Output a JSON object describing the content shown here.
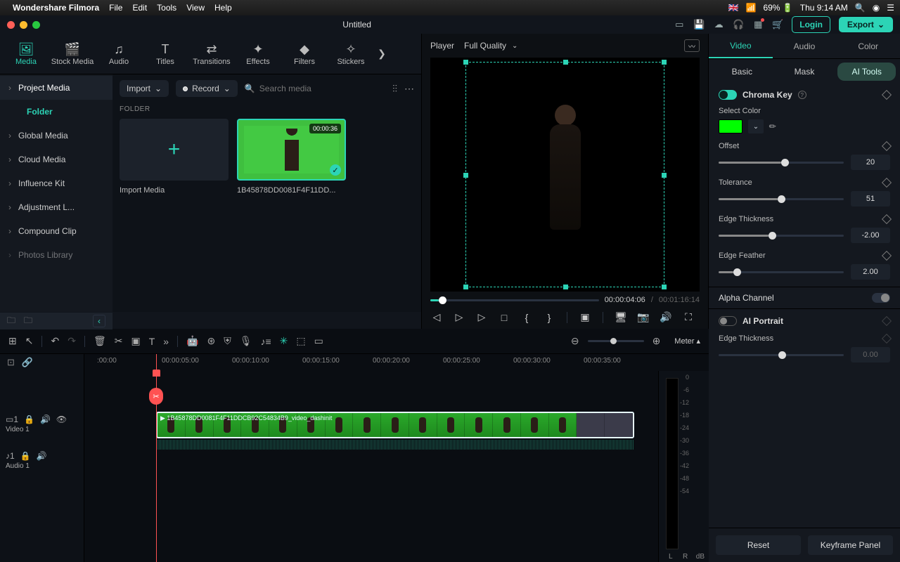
{
  "menubar": {
    "app": "Wondershare Filmora",
    "items": [
      "File",
      "Edit",
      "Tools",
      "View",
      "Help"
    ],
    "status": {
      "flag": "🇬🇧",
      "wifi": "📶",
      "battery": "69% 🔋",
      "clock": "Thu 9:14 AM"
    }
  },
  "titlebar": {
    "title": "Untitled",
    "login": "Login",
    "export": "Export"
  },
  "media": {
    "tabs": [
      "Media",
      "Stock Media",
      "Audio",
      "Titles",
      "Transitions",
      "Effects",
      "Filters",
      "Stickers"
    ],
    "side": {
      "project": "Project Media",
      "folder": "Folder",
      "items": [
        "Global Media",
        "Cloud Media",
        "Influence Kit",
        "Adjustment L...",
        "Compound Clip",
        "Photos Library"
      ]
    },
    "toolbar": {
      "import": "Import",
      "record": "Record",
      "search_placeholder": "Search media"
    },
    "folder_label": "FOLDER",
    "cards": {
      "import": "Import Media",
      "clip_name": "1B45878DD0081F4F11DD...",
      "clip_dur": "00:00:36"
    }
  },
  "player": {
    "label": "Player",
    "quality": "Full Quality",
    "current": "00:00:04:06",
    "total": "00:01:16:14"
  },
  "props": {
    "tabs": [
      "Video",
      "Audio",
      "Color"
    ],
    "subtabs": [
      "Basic",
      "Mask",
      "AI Tools"
    ],
    "chroma": {
      "title": "Chroma Key",
      "select_color": "Select Color",
      "color": "#00ff00"
    },
    "offset": {
      "label": "Offset",
      "value": "20",
      "pct": 50
    },
    "tolerance": {
      "label": "Tolerance",
      "value": "51",
      "pct": 47
    },
    "edge_thickness": {
      "label": "Edge Thickness",
      "value": "-2.00",
      "pct": 40
    },
    "edge_feather": {
      "label": "Edge Feather",
      "value": "2.00",
      "pct": 12
    },
    "alpha": {
      "label": "Alpha Channel"
    },
    "ai_portrait": {
      "label": "AI Portrait"
    },
    "ai_edge_thick": {
      "label": "Edge Thickness",
      "value": "0.00"
    },
    "footer": {
      "reset": "Reset",
      "kf": "Keyframe Panel"
    }
  },
  "timeline": {
    "ticks": [
      ":00:00",
      "00:00:05:00",
      "00:00:10:00",
      "00:00:15:00",
      "00:00:20:00",
      "00:00:25:00",
      "00:00:30:00",
      "00:00:35:00"
    ],
    "video_track": "Video 1",
    "audio_track": "Audio 1",
    "clip_label": "1B45878DD0081F4F11DDCB92C54834B9_video_dashinit",
    "meter_label": "Meter ▴",
    "db_scale": [
      "0",
      "-6",
      "-12",
      "-18",
      "-24",
      "-30",
      "-36",
      "-42",
      "-48",
      "-54",
      "dB"
    ],
    "lr": "L   R"
  }
}
